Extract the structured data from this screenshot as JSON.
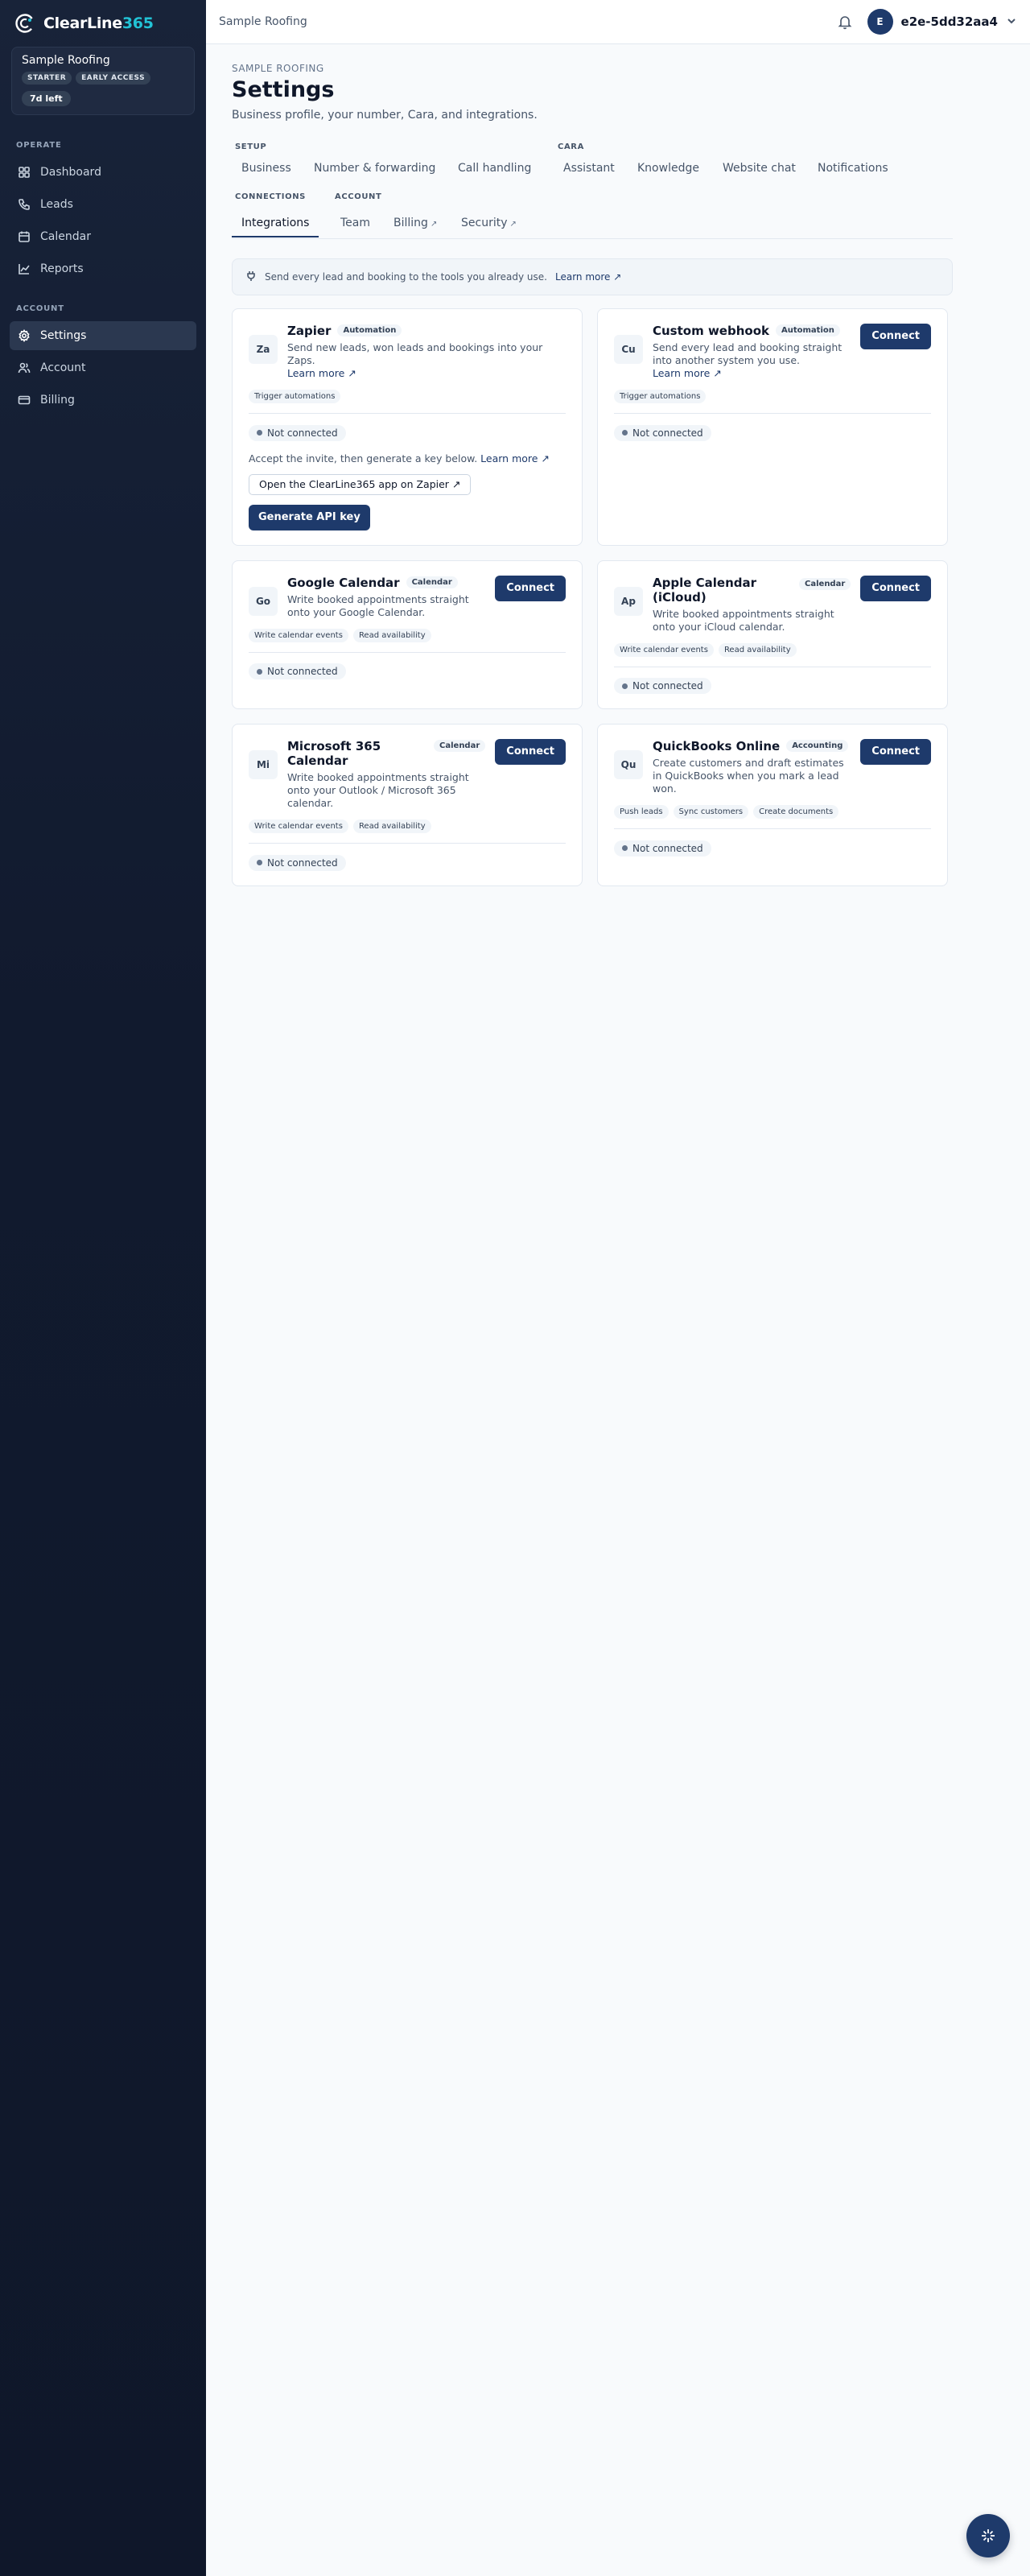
{
  "brand": {
    "name_main": "ClearLine",
    "name_accent": "365",
    "accent_color": "#22c3d6"
  },
  "org": {
    "name": "Sample Roofing",
    "badges": [
      "STARTER",
      "EARLY ACCESS"
    ],
    "trial": "7d left"
  },
  "sidebar": {
    "operate_label": "OPERATE",
    "operate_items": [
      {
        "label": "Dashboard",
        "icon": "grid-icon"
      },
      {
        "label": "Leads",
        "icon": "phone-icon"
      },
      {
        "label": "Calendar",
        "icon": "calendar-icon"
      },
      {
        "label": "Reports",
        "icon": "chart-icon"
      }
    ],
    "account_label": "ACCOUNT",
    "account_items": [
      {
        "label": "Settings",
        "icon": "gear-icon",
        "active": true
      },
      {
        "label": "Account",
        "icon": "users-icon"
      },
      {
        "label": "Billing",
        "icon": "card-icon"
      }
    ]
  },
  "topbar": {
    "org": "Sample Roofing",
    "avatar_initial": "E",
    "user": "e2e-5dd32aa4"
  },
  "page": {
    "eyebrow": "SAMPLE ROOFING",
    "title": "Settings",
    "subtitle": "Business profile, your number, Cara, and integrations."
  },
  "tab_groups": {
    "setup": "SETUP",
    "cara": "CARA",
    "connections": "CONNECTIONS",
    "account": "ACCOUNT"
  },
  "tabs": {
    "business": "Business",
    "number": "Number & forwarding",
    "call_handling": "Call handling",
    "assistant": "Assistant",
    "knowledge": "Knowledge",
    "website_chat": "Website chat",
    "notifications": "Notifications",
    "integrations": "Integrations",
    "team": "Team",
    "billing": "Billing",
    "security": "Security",
    "ext": "↗"
  },
  "banner": {
    "text": "Send every lead and booking to the tools you already use.",
    "link": "Learn more ↗"
  },
  "status_label": "Not connected",
  "connect_label": "Connect",
  "zapier": {
    "tile": "Za",
    "name": "Zapier",
    "category": "Automation",
    "desc": "Send new leads, won leads and bookings into your Zaps.",
    "link": "Learn more ↗",
    "caps": [
      "Trigger automations"
    ],
    "hint": "Accept the invite, then generate a key below.",
    "hint_link": "Learn more ↗",
    "open_app": "Open the ClearLine365 app on Zapier ↗",
    "generate": "Generate API key"
  },
  "webhook": {
    "tile": "Cu",
    "name": "Custom webhook",
    "category": "Automation",
    "desc": "Send every lead and booking straight into another system you use.",
    "link": "Learn more ↗",
    "caps": [
      "Trigger automations"
    ]
  },
  "google": {
    "tile": "Go",
    "name": "Google Calendar",
    "category": "Calendar",
    "desc": "Write booked appointments straight onto your Google Calendar.",
    "caps": [
      "Write calendar events",
      "Read availability"
    ]
  },
  "apple": {
    "tile": "Ap",
    "name": "Apple Calendar (iCloud)",
    "category": "Calendar",
    "desc": "Write booked appointments straight onto your iCloud calendar.",
    "caps": [
      "Write calendar events",
      "Read availability"
    ]
  },
  "microsoft": {
    "tile": "Mi",
    "name": "Microsoft 365 Calendar",
    "category": "Calendar",
    "desc": "Write booked appointments straight onto your Outlook / Microsoft 365 calendar.",
    "caps": [
      "Write calendar events",
      "Read availability"
    ]
  },
  "quickbooks": {
    "tile": "Qu",
    "name": "QuickBooks Online",
    "category": "Accounting",
    "desc": "Create customers and draft estimates in QuickBooks when you mark a lead won.",
    "caps": [
      "Push leads",
      "Sync customers",
      "Create documents"
    ]
  }
}
